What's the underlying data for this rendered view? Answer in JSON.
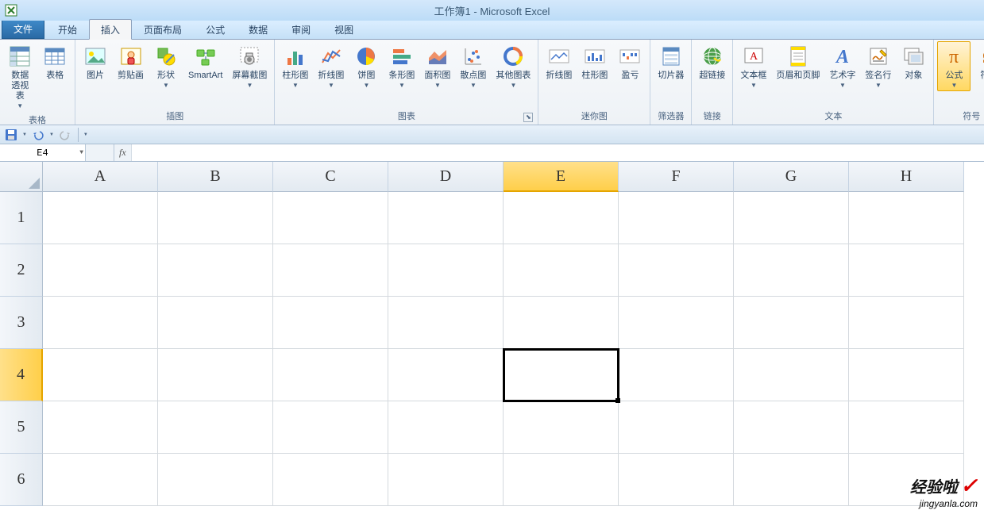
{
  "title": "工作簿1 - Microsoft Excel",
  "tabs": {
    "file": "文件",
    "home": "开始",
    "insert": "插入",
    "layout": "页面布局",
    "formulas": "公式",
    "data": "数据",
    "review": "审阅",
    "view": "视图"
  },
  "ribbon": {
    "tables": {
      "label": "表格",
      "pivot": "数据\n透视表",
      "table": "表格"
    },
    "illustrations": {
      "label": "插图",
      "picture": "图片",
      "clipart": "剪贴画",
      "shapes": "形状",
      "smartart": "SmartArt",
      "screenshot": "屏幕截图"
    },
    "charts": {
      "label": "图表",
      "column": "柱形图",
      "line": "折线图",
      "pie": "饼图",
      "bar": "条形图",
      "area": "面积图",
      "scatter": "散点图",
      "other": "其他图表"
    },
    "sparklines": {
      "label": "迷你图",
      "line": "折线图",
      "column": "柱形图",
      "winloss": "盈亏"
    },
    "filter": {
      "label": "筛选器",
      "slicer": "切片器"
    },
    "links": {
      "label": "链接",
      "hyperlink": "超链接"
    },
    "text": {
      "label": "文本",
      "textbox": "文本框",
      "headerfooter": "页眉和页脚",
      "wordart": "艺术字",
      "sigline": "签名行",
      "object": "对象"
    },
    "symbols": {
      "label": "符号",
      "equation": "公式",
      "symbol": "符号"
    }
  },
  "formula_bar": {
    "name_box": "E4",
    "fx": "fx",
    "value": ""
  },
  "columns": [
    "A",
    "B",
    "C",
    "D",
    "E",
    "F",
    "G",
    "H"
  ],
  "rows": [
    "1",
    "2",
    "3",
    "4",
    "5",
    "6"
  ],
  "selected": {
    "col": 4,
    "row": 3
  },
  "watermark": {
    "line1": "经验啦",
    "line2": "jingyanla.com"
  }
}
